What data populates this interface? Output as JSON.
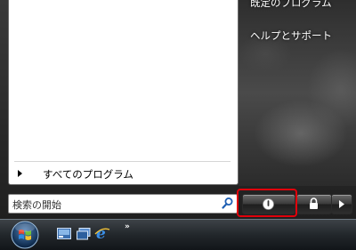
{
  "right_panel": {
    "items": [
      {
        "label": "既定のプログラム"
      },
      {
        "label": "ヘルプとサポート"
      }
    ]
  },
  "left_panel": {
    "all_programs_label": "すべてのプログラム"
  },
  "search": {
    "placeholder": "検索の開始"
  },
  "taskbar": {
    "overflow_label": "»"
  },
  "colors": {
    "highlight": "#e0000b",
    "panel": "#ffffff"
  }
}
